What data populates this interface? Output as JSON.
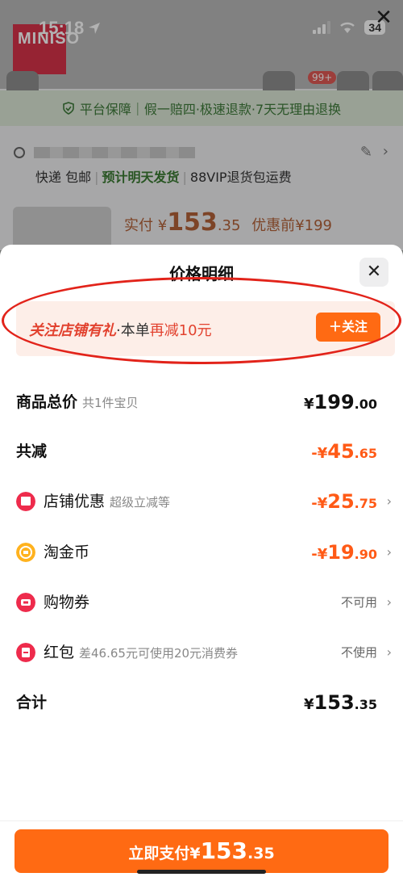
{
  "status_bar": {
    "time": "15:18",
    "battery": "34"
  },
  "background": {
    "brand_logo_text": "MINISO",
    "cart_badge": "99+",
    "guarantee_text": "平台保障｜假一赔四·极速退款·7天无理由退换",
    "shipping": {
      "method": "快递 包邮",
      "estimate": "预计明天发货",
      "vip": "88VIP退货包运费"
    },
    "price": {
      "label": "实付",
      "currency": "¥",
      "integer": "153",
      "decimal": ".35",
      "original_label": "优惠前",
      "original": "¥199"
    }
  },
  "sheet": {
    "title": "价格明细",
    "promo": {
      "highlight": "关注店铺有礼",
      "middle": "·本单",
      "red": "再减10元",
      "button": "＋关注"
    },
    "rows": {
      "total": {
        "label": "商品总价",
        "sub": "共1件宝贝",
        "currency": "¥",
        "integer": "199",
        "decimal": ".00"
      },
      "reduced": {
        "label": "共减",
        "currency": "-¥",
        "integer": "45",
        "decimal": ".65"
      },
      "shop_discount": {
        "label": "店铺优惠",
        "sub": "超级立减等",
        "currency": "-¥",
        "integer": "25",
        "decimal": ".75"
      },
      "coins": {
        "label": "淘金币",
        "currency": "-¥",
        "integer": "19",
        "decimal": ".90"
      },
      "coupon": {
        "label": "购物券",
        "status": "不可用"
      },
      "redpacket": {
        "label": "红包",
        "sub": "差46.65元可使用20元消费券",
        "status": "不使用"
      },
      "sum": {
        "label": "合计",
        "currency": "¥",
        "integer": "153",
        "decimal": ".35"
      }
    },
    "pay": {
      "label": "立即支付",
      "currency": "¥",
      "integer": "153",
      "decimal": ".35"
    }
  },
  "colors": {
    "accent": "#ff6a13",
    "discount": "#ff5a16",
    "promo_red": "#e2422f",
    "annotation_red": "#e2231a"
  }
}
